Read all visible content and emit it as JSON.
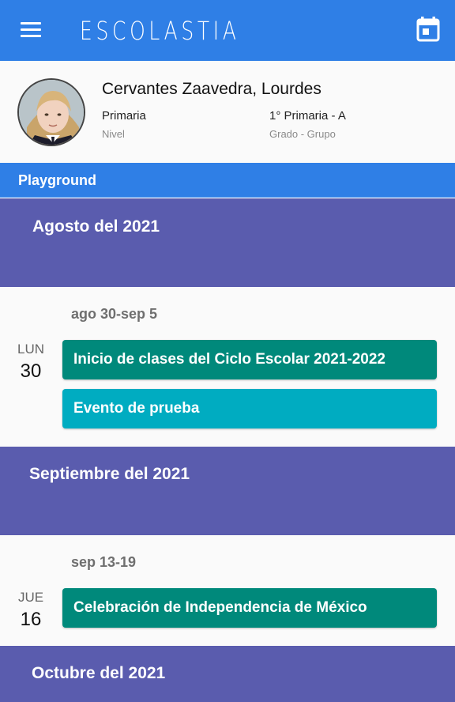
{
  "app": {
    "title": "ESCOLASTIA"
  },
  "profile": {
    "name": "Cervantes Zaavedra, Lourdes",
    "level_value": "Primaria",
    "level_label": "Nivel",
    "group_value": "1° Primaria - A",
    "group_label": "Grado - Grupo"
  },
  "school": {
    "name": "Playground"
  },
  "calendar": {
    "months": [
      {
        "label": "Agosto del 2021"
      },
      {
        "label": "Septiembre del 2021"
      },
      {
        "label": "Octubre del 2021"
      }
    ],
    "weeks": [
      {
        "range": "ago 30-sep 5",
        "day_name": "LUN",
        "day_number": "30",
        "events": [
          {
            "title": "Inicio de clases del Ciclo Escolar 2021-2022",
            "color": "#00897b"
          },
          {
            "title": "Evento de prueba",
            "color": "#00acc1"
          }
        ]
      },
      {
        "range": "sep 13-19",
        "day_name": "JUE",
        "day_number": "16",
        "events": [
          {
            "title": "Celebración de Independencia de México",
            "color": "#00897b"
          }
        ]
      }
    ]
  },
  "colors": {
    "appbar": "#2f7fe6",
    "month_header": "#5a5cae",
    "event_primary": "#00897b",
    "event_secondary": "#00acc1"
  },
  "icons": {
    "menu": "menu-icon",
    "calendar": "calendar-icon"
  }
}
